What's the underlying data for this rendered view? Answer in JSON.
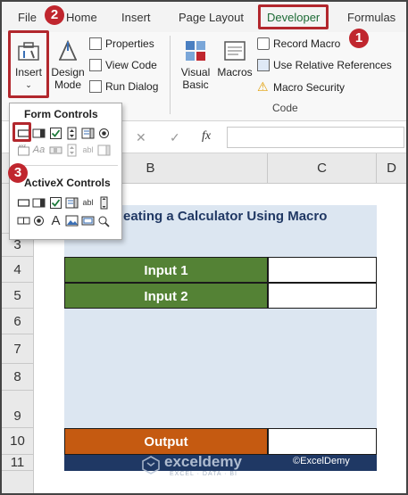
{
  "ribbon_tabs": {
    "file": "File",
    "home": "Home",
    "insert": "Insert",
    "page_layout": "Page Layout",
    "developer": "Developer",
    "formulas": "Formulas"
  },
  "ribbon": {
    "insert_label": "Insert",
    "design_mode_line1": "Design",
    "design_mode_line2": "Mode",
    "properties": "Properties",
    "view_code": "View Code",
    "run_dialog": "Run Dialog",
    "visual_basic_line1": "Visual",
    "visual_basic_line2": "Basic",
    "macros": "Macros",
    "record_macro": "Record Macro",
    "use_relative_references": "Use Relative References",
    "macro_security": "Macro Security",
    "code_group": "Code"
  },
  "formula_bar": {
    "fx": "fx"
  },
  "controls_panel": {
    "form_controls": "Form Controls",
    "activex_controls": "ActiveX Controls"
  },
  "columns": [
    "B",
    "C",
    "D"
  ],
  "rows": [
    "3",
    "4",
    "5",
    "6",
    "7",
    "8",
    "9",
    "10",
    "11"
  ],
  "sheet": {
    "title": "eating a Calculator Using Macro",
    "input1": "Input 1",
    "input2": "Input 2",
    "output": "Output",
    "footer_brand": "exceldemy",
    "footer_tagline": "EXCEL · DATA · BI",
    "copyright": "©ExcelDemy"
  },
  "callouts": {
    "step1": "1",
    "step2": "2",
    "step3": "3"
  },
  "colors": {
    "green_cell": "#548235",
    "orange_cell": "#c55a11",
    "light_blue": "#dce6f1",
    "title_blue": "#203864",
    "footer_navy": "#1f3864",
    "callout_red": "#c0262e"
  }
}
